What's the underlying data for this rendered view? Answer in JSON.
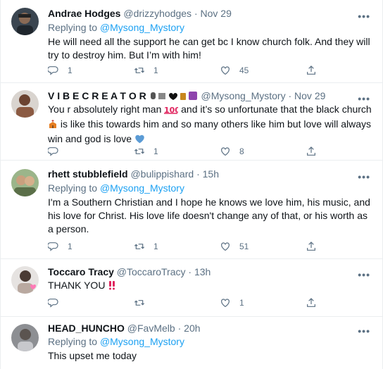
{
  "tweets": [
    {
      "name": "Andrae Hodges",
      "handle": "@drizzyhodges",
      "time": "Nov 29",
      "replying_prefix": "Replying to",
      "replying_to": "@Mysong_Mystory",
      "text": "He will need all the support he can get bc I know church folk. And they will try to destroy him. But I’m with him!",
      "replies": "1",
      "retweets": "1",
      "likes": "45"
    },
    {
      "name": "V I B E C R E A T O R",
      "handle": "@Mysong_Mystory",
      "time": "Nov 29",
      "text_part1": "You r absolutely right man",
      "text_part2": "and it’s so unfortunate that the black church",
      "text_part3": "is like this towards him and so many others like him but love will always win and god is love",
      "replies": "",
      "retweets": "1",
      "likes": "8"
    },
    {
      "name": "rhett stubblefield",
      "handle": "@bulippishard",
      "time": "15h",
      "replying_prefix": "Replying to",
      "replying_to": "@Mysong_Mystory",
      "text": "I'm a Southern Christian and I hope he knows we love him, his music, and his love for Christ.  His love life doesn't change any of that, or his worth as a person.",
      "replies": "1",
      "retweets": "1",
      "likes": "51"
    },
    {
      "name": "Toccaro Tracy",
      "handle": "@ToccaroTracy",
      "time": "13h",
      "text": "THANK YOU",
      "replies": "",
      "retweets": "",
      "likes": "1"
    },
    {
      "name": "HEAD_HUNCHO",
      "handle": "@FavMelb",
      "time": "20h",
      "replying_prefix": "Replying to",
      "replying_to": "@Mysong_Mystory",
      "text": "This upset me today"
    }
  ],
  "colors": {
    "accent": "#1da1f2",
    "secondary_text": "#5b7083",
    "divider": "#ebeef0",
    "heart": "#5b9bd5"
  },
  "icons": [
    "reply-icon",
    "retweet-icon",
    "like-icon",
    "share-icon",
    "more-icon"
  ]
}
